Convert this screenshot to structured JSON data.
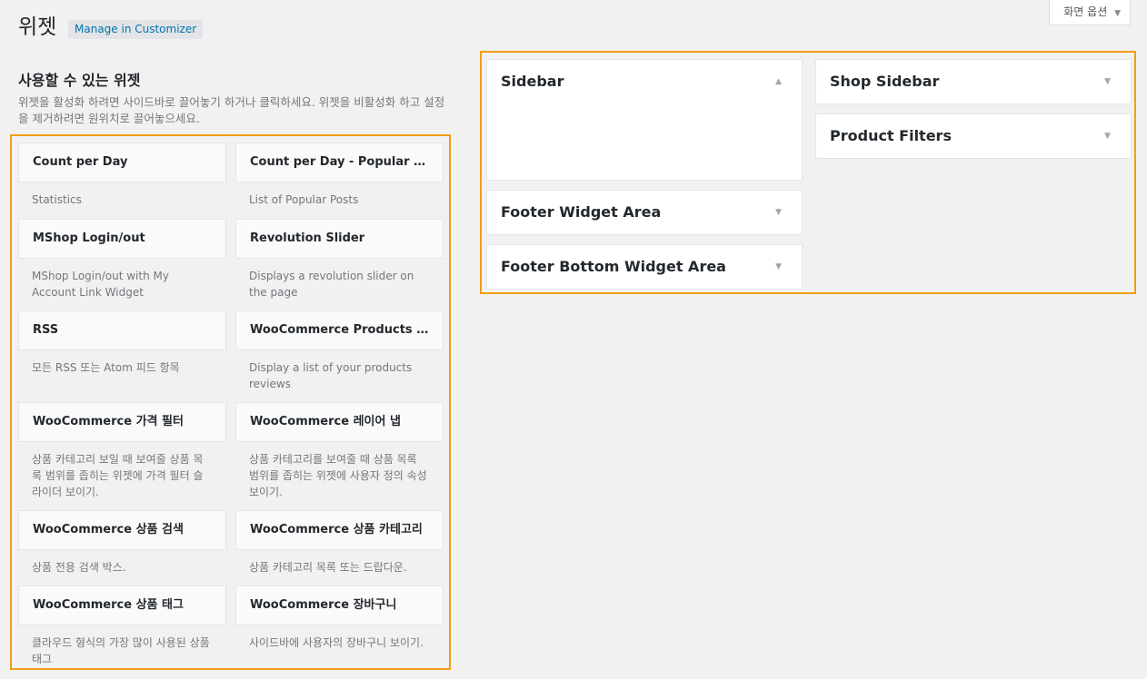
{
  "header": {
    "title": "위젯",
    "customizer_label": "Manage in Customizer",
    "screen_options_label": "화면 옵션",
    "screen_options_caret": "▼"
  },
  "available": {
    "title": "사용할 수 있는 위젯",
    "description": "위젯을 활성화 하려면 사이드바로 끌어놓기 하거나 클릭하세요. 위젯을 비활성화 하고 설정을 제거하려면 원위치로 끌어놓으세요.",
    "widgets": [
      {
        "name": "Count per Day",
        "desc": "Statistics"
      },
      {
        "name": "Count per Day - Popular Posts",
        "desc": "List of Popular Posts"
      },
      {
        "name": "MShop Login/out",
        "desc": "MShop Login/out with My Account Link Widget"
      },
      {
        "name": "Revolution Slider",
        "desc": "Displays a revolution slider on the page"
      },
      {
        "name": "RSS",
        "desc": "모든 RSS 또는 Atom 피드 항목"
      },
      {
        "name": "WooCommerce Products Revi…",
        "desc": "Display a list of your products reviews"
      },
      {
        "name": "WooCommerce 가격 필터",
        "desc": "상품 카테고리 보일 때 보여줄 상품 목록 범위를 좁히는 위젯에 가격 필터 슬라이더 보이기."
      },
      {
        "name": "WooCommerce 레이어 냅",
        "desc": "상품 카테고리를 보여줄 때 상품 목록 범위를 좁히는 위젯에 사용자 정의 속성 보이기."
      },
      {
        "name": "WooCommerce 상품 검색",
        "desc": "상품 전용 검색 박스."
      },
      {
        "name": "WooCommerce 상품 카테고리",
        "desc": "상품 카테고리 목록 또는 드랍다운."
      },
      {
        "name": "WooCommerce 상품 태그",
        "desc": "클라우드 형식의 가장 많이 사용된 상품 태그"
      },
      {
        "name": "WooCommerce 장바구니",
        "desc": "사이드바에 사용자의 장바구니 보이기."
      }
    ]
  },
  "sidebars": {
    "sidebar": {
      "name": "Sidebar",
      "toggle": "▲"
    },
    "shop_sidebar": {
      "name": "Shop Sidebar",
      "toggle": "▼"
    },
    "product_filters": {
      "name": "Product Filters",
      "toggle": "▼"
    },
    "footer_widget_area": {
      "name": "Footer Widget Area",
      "toggle": "▼"
    },
    "footer_bottom": {
      "name": "Footer Bottom Widget Area",
      "toggle": "▼"
    }
  },
  "colors": {
    "highlight_border": "#f39c12",
    "link": "#0073aa",
    "background": "#f1f1f1"
  }
}
